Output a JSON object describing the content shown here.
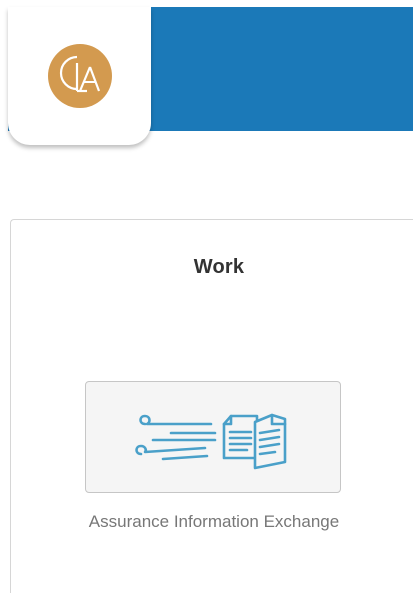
{
  "colors": {
    "header_blue": "#1b79b8",
    "logo_tan": "#d39a4f",
    "icon_blue": "#4aa0c9"
  },
  "logo": {
    "icon": "cla-logo-icon",
    "text": "CLA"
  },
  "section": {
    "title": "Work"
  },
  "apps": [
    {
      "icon": "wind-documents-icon",
      "label": "Assurance Information Exchange"
    }
  ]
}
